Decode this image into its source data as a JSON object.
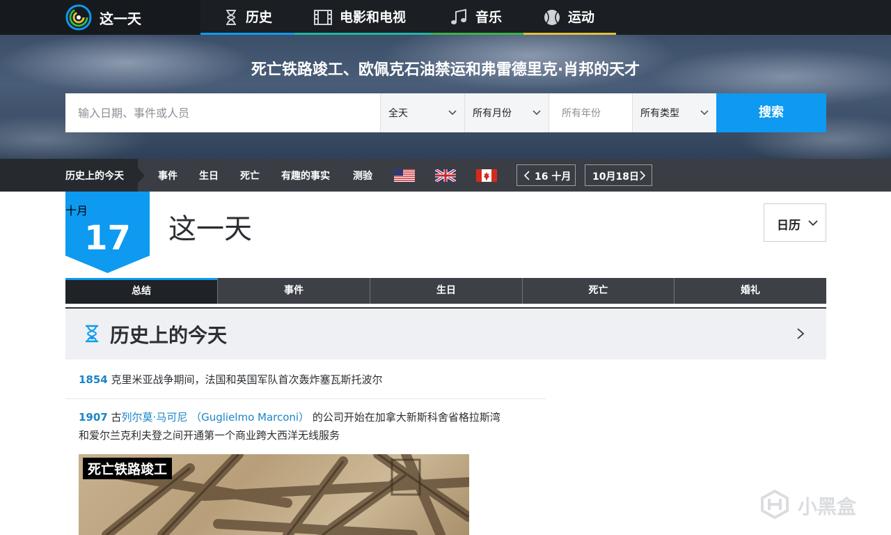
{
  "brand": {
    "name": "这一天"
  },
  "nav": {
    "tabs": [
      {
        "label": "历史",
        "icon": "hourglass-icon",
        "color": "#0d9af0"
      },
      {
        "label": "电影和电视",
        "icon": "film-icon",
        "color": "#1fb7a6"
      },
      {
        "label": "音乐",
        "icon": "music-note-icon",
        "color": "#39b54a"
      },
      {
        "label": "运动",
        "icon": "ball-icon",
        "color": "#e0c23a"
      }
    ]
  },
  "hero": {
    "title": "死亡铁路竣工、欧佩克石油禁运和弗雷德里克·肖邦的天才"
  },
  "search": {
    "placeholder": "输入日期、事件或人员",
    "time_select": "全天",
    "month_select": "所有月份",
    "year_placeholder": "所有年份",
    "type_select": "所有类型",
    "button": "搜索"
  },
  "subnav": {
    "active": "历史上的今天",
    "items": [
      "事件",
      "生日",
      "死亡",
      "有趣的事实",
      "测验"
    ],
    "flags": [
      "us-flag-icon",
      "uk-flag-icon",
      "canada-flag-icon"
    ],
    "prev_day": "16 十月",
    "next_day": "10月18日"
  },
  "date_badge": {
    "month": "十月",
    "day": "17"
  },
  "page_title": "这一天",
  "calendar_button": "日历",
  "tabs": [
    {
      "label": "总结",
      "active": true
    },
    {
      "label": "事件",
      "active": false
    },
    {
      "label": "生日",
      "active": false
    },
    {
      "label": "死亡",
      "active": false
    },
    {
      "label": "婚礼",
      "active": false
    }
  ],
  "section": {
    "title": "历史上的今天",
    "icon": "hourglass-icon"
  },
  "entries": [
    {
      "year": "1854",
      "text": "克里米亚战争期间，法国和英国军队首次轰炸塞瓦斯托波尔"
    },
    {
      "year": "1907",
      "prefix": "古",
      "link": "列尔莫·马可尼 （Guglielmo Marconi）",
      "text_line1": " 的公司开始在加拿大新斯科舍省格拉斯湾",
      "text_line2": "和爱尔兰克利夫登之间开通第一个商业跨大西洋无线服务"
    }
  ],
  "feature_image": {
    "caption": "死亡铁路竣工"
  },
  "watermark": {
    "text": "小黑盒"
  },
  "colors": {
    "accent": "#0d9af0",
    "link": "#1a84c8",
    "nav_bg": "#1b1f24",
    "subnav_bg": "#3a3e44"
  }
}
